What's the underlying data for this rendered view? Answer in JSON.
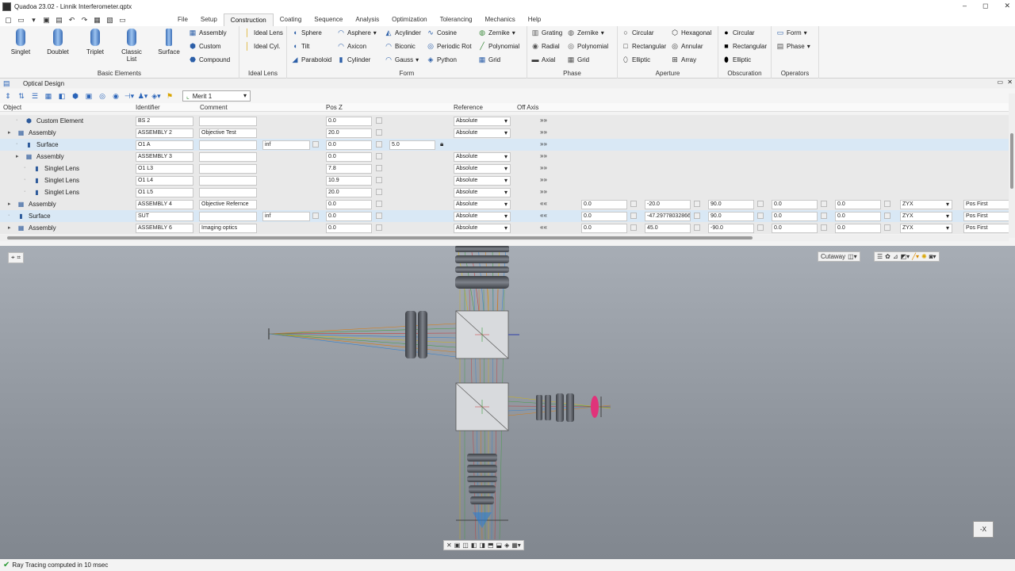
{
  "window": {
    "title": "Quadoa 23.02 - Linnik Interferometer.qptx",
    "minimize": "–",
    "maximize": "◻",
    "close": "✕"
  },
  "menu": [
    "File",
    "Setup",
    "Construction",
    "Coating",
    "Sequence",
    "Analysis",
    "Optimization",
    "Tolerancing",
    "Mechanics",
    "Help"
  ],
  "menu_active": "Construction",
  "ribbon": {
    "basic": {
      "label": "Basic Elements",
      "singlet": "Singlet",
      "doublet": "Doublet",
      "triplet": "Triplet",
      "classic1": "Classic",
      "classic2": "List",
      "surface": "Surface",
      "assembly": "Assembly",
      "custom": "Custom",
      "compound": "Compound"
    },
    "ideal": {
      "label": "Ideal Lens",
      "ideal_lens": "Ideal Lens",
      "ideal_cyl": "Ideal Cyl."
    },
    "form": {
      "label": "Form",
      "sphere": "Sphere",
      "tilt": "Tilt",
      "paraboloid": "Paraboloid",
      "asphere": "Asphere",
      "axicon": "Axicon",
      "cylinder": "Cylinder",
      "acylinder": "Acylinder",
      "biconic": "Biconic",
      "gauss": "Gauss",
      "cosine": "Cosine",
      "periodic_rot": "Periodic Rot",
      "python": "Python",
      "zernike": "Zernike",
      "polynomial": "Polynomial",
      "grid": "Grid"
    },
    "phase": {
      "label": "Phase",
      "grating": "Grating",
      "radial": "Radial",
      "axial": "Axial",
      "zernike": "Zernike",
      "polynomial": "Polynomial",
      "grid": "Grid"
    },
    "aperture": {
      "label": "Aperture",
      "circular": "Circular",
      "rectangular": "Rectangular",
      "elliptic": "Elliptic",
      "hexagonal": "Hexagonal",
      "annular": "Annular",
      "array": "Array"
    },
    "obscuration": {
      "label": "Obscuration",
      "circular": "Circular",
      "rectangular": "Rectangular",
      "elliptic": "Elliptic"
    },
    "operators": {
      "label": "Operators",
      "form": "Form",
      "phase": "Phase"
    }
  },
  "panel": {
    "title": "Optical Design",
    "merit": "Merit 1"
  },
  "columns": {
    "object": "Object",
    "identifier": "Identifier",
    "comment": "Comment",
    "posz": "Pos Z",
    "reference": "Reference",
    "offaxis": "Off Axis"
  },
  "rows": [
    {
      "name": "Custom Element",
      "icon": "⬢",
      "id": "BS 2",
      "comment": "",
      "radius": "",
      "posz": "0.0",
      "extra": "",
      "ref": "Absolute",
      "arrows": "»»",
      "off": []
    },
    {
      "name": "Assembly",
      "icon": "▦",
      "id": "ASSEMBLY 2",
      "comment": "Objective Test",
      "radius": "",
      "posz": "20.0",
      "extra": "",
      "ref": "Absolute",
      "arrows": "»»",
      "off": []
    },
    {
      "name": "Surface",
      "icon": "▮",
      "id": "O1 A",
      "comment": "",
      "radius": "inf",
      "posz": "0.0",
      "extra": "5.0",
      "ref": "",
      "arrows": "»»",
      "off": []
    },
    {
      "name": "Assembly",
      "icon": "▦",
      "id": "ASSEMBLY 3",
      "comment": "",
      "radius": "",
      "posz": "0.0",
      "extra": "",
      "ref": "Absolute",
      "arrows": "»»",
      "off": []
    },
    {
      "name": "Singlet Lens",
      "icon": "▮",
      "id": "O1 L3",
      "comment": "",
      "radius": "",
      "posz": "7.8",
      "extra": "",
      "ref": "Absolute",
      "arrows": "»»",
      "off": []
    },
    {
      "name": "Singlet Lens",
      "icon": "▮",
      "id": "O1 L4",
      "comment": "",
      "radius": "",
      "posz": "10.9",
      "extra": "",
      "ref": "Absolute",
      "arrows": "»»",
      "off": []
    },
    {
      "name": "Singlet Lens",
      "icon": "▮",
      "id": "O1 L5",
      "comment": "",
      "radius": "",
      "posz": "20.0",
      "extra": "",
      "ref": "Absolute",
      "arrows": "»»",
      "off": []
    },
    {
      "name": "Assembly",
      "icon": "▦",
      "id": "ASSEMBLY 4",
      "comment": "Objective Refernce",
      "radius": "",
      "posz": "0.0",
      "extra": "",
      "ref": "Absolute",
      "arrows": "««",
      "off": [
        "0.0",
        "-20.0",
        "90.0",
        "0.0",
        "0.0",
        "ZYX",
        "Pos First"
      ]
    },
    {
      "name": "Surface",
      "icon": "▮",
      "id": "SUT",
      "comment": "",
      "radius": "inf",
      "posz": "0.0",
      "extra": "",
      "ref": "Absolute",
      "arrows": "««",
      "off": [
        "0.0",
        "-47.29778032866",
        "90.0",
        "0.0",
        "0.0",
        "ZYX",
        "Pos First"
      ]
    },
    {
      "name": "Assembly",
      "icon": "▦",
      "id": "ASSEMBLY 6",
      "comment": "Imaging optics",
      "radius": "",
      "posz": "0.0",
      "extra": "",
      "ref": "Absolute",
      "arrows": "««",
      "off": [
        "0.0",
        "45.0",
        "-90.0",
        "0.0",
        "0.0",
        "ZYX",
        "Pos First"
      ]
    }
  ],
  "viewport": {
    "cutaway": "Cutaway",
    "axis_button": "-X"
  },
  "status": {
    "text": "Ray Tracing computed in 10 msec"
  }
}
